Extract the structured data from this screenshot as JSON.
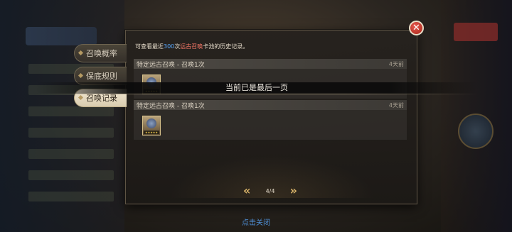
{
  "tabs": [
    {
      "label": "召唤概率",
      "active": false
    },
    {
      "label": "保底规则",
      "active": false
    },
    {
      "label": "召唤记录",
      "active": true
    }
  ],
  "notice": {
    "prefix": "可查看最近",
    "count": "300",
    "mid": "次",
    "pool": "远古召唤",
    "suffix": "卡池的历史记录。"
  },
  "records": [
    {
      "title": "特定远古召唤 - 召唤1次",
      "time": "4天前",
      "icon": "hero-portrait-icon"
    },
    {
      "title": "特定远古召唤 - 召唤1次",
      "time": "4天前",
      "icon": "hero-portrait-icon"
    }
  ],
  "toast": "当前已是最后一页",
  "pager": {
    "prev": "«",
    "text": "4/4",
    "next": "»"
  },
  "close": "✕",
  "tap_close": "点击关闭",
  "colors": {
    "accent_gold": "#d9b46a",
    "count_blue": "#5aa9ff",
    "pool_red": "#ff7a6a",
    "close_red": "#c9392c",
    "link_blue": "#4f8fd6"
  }
}
